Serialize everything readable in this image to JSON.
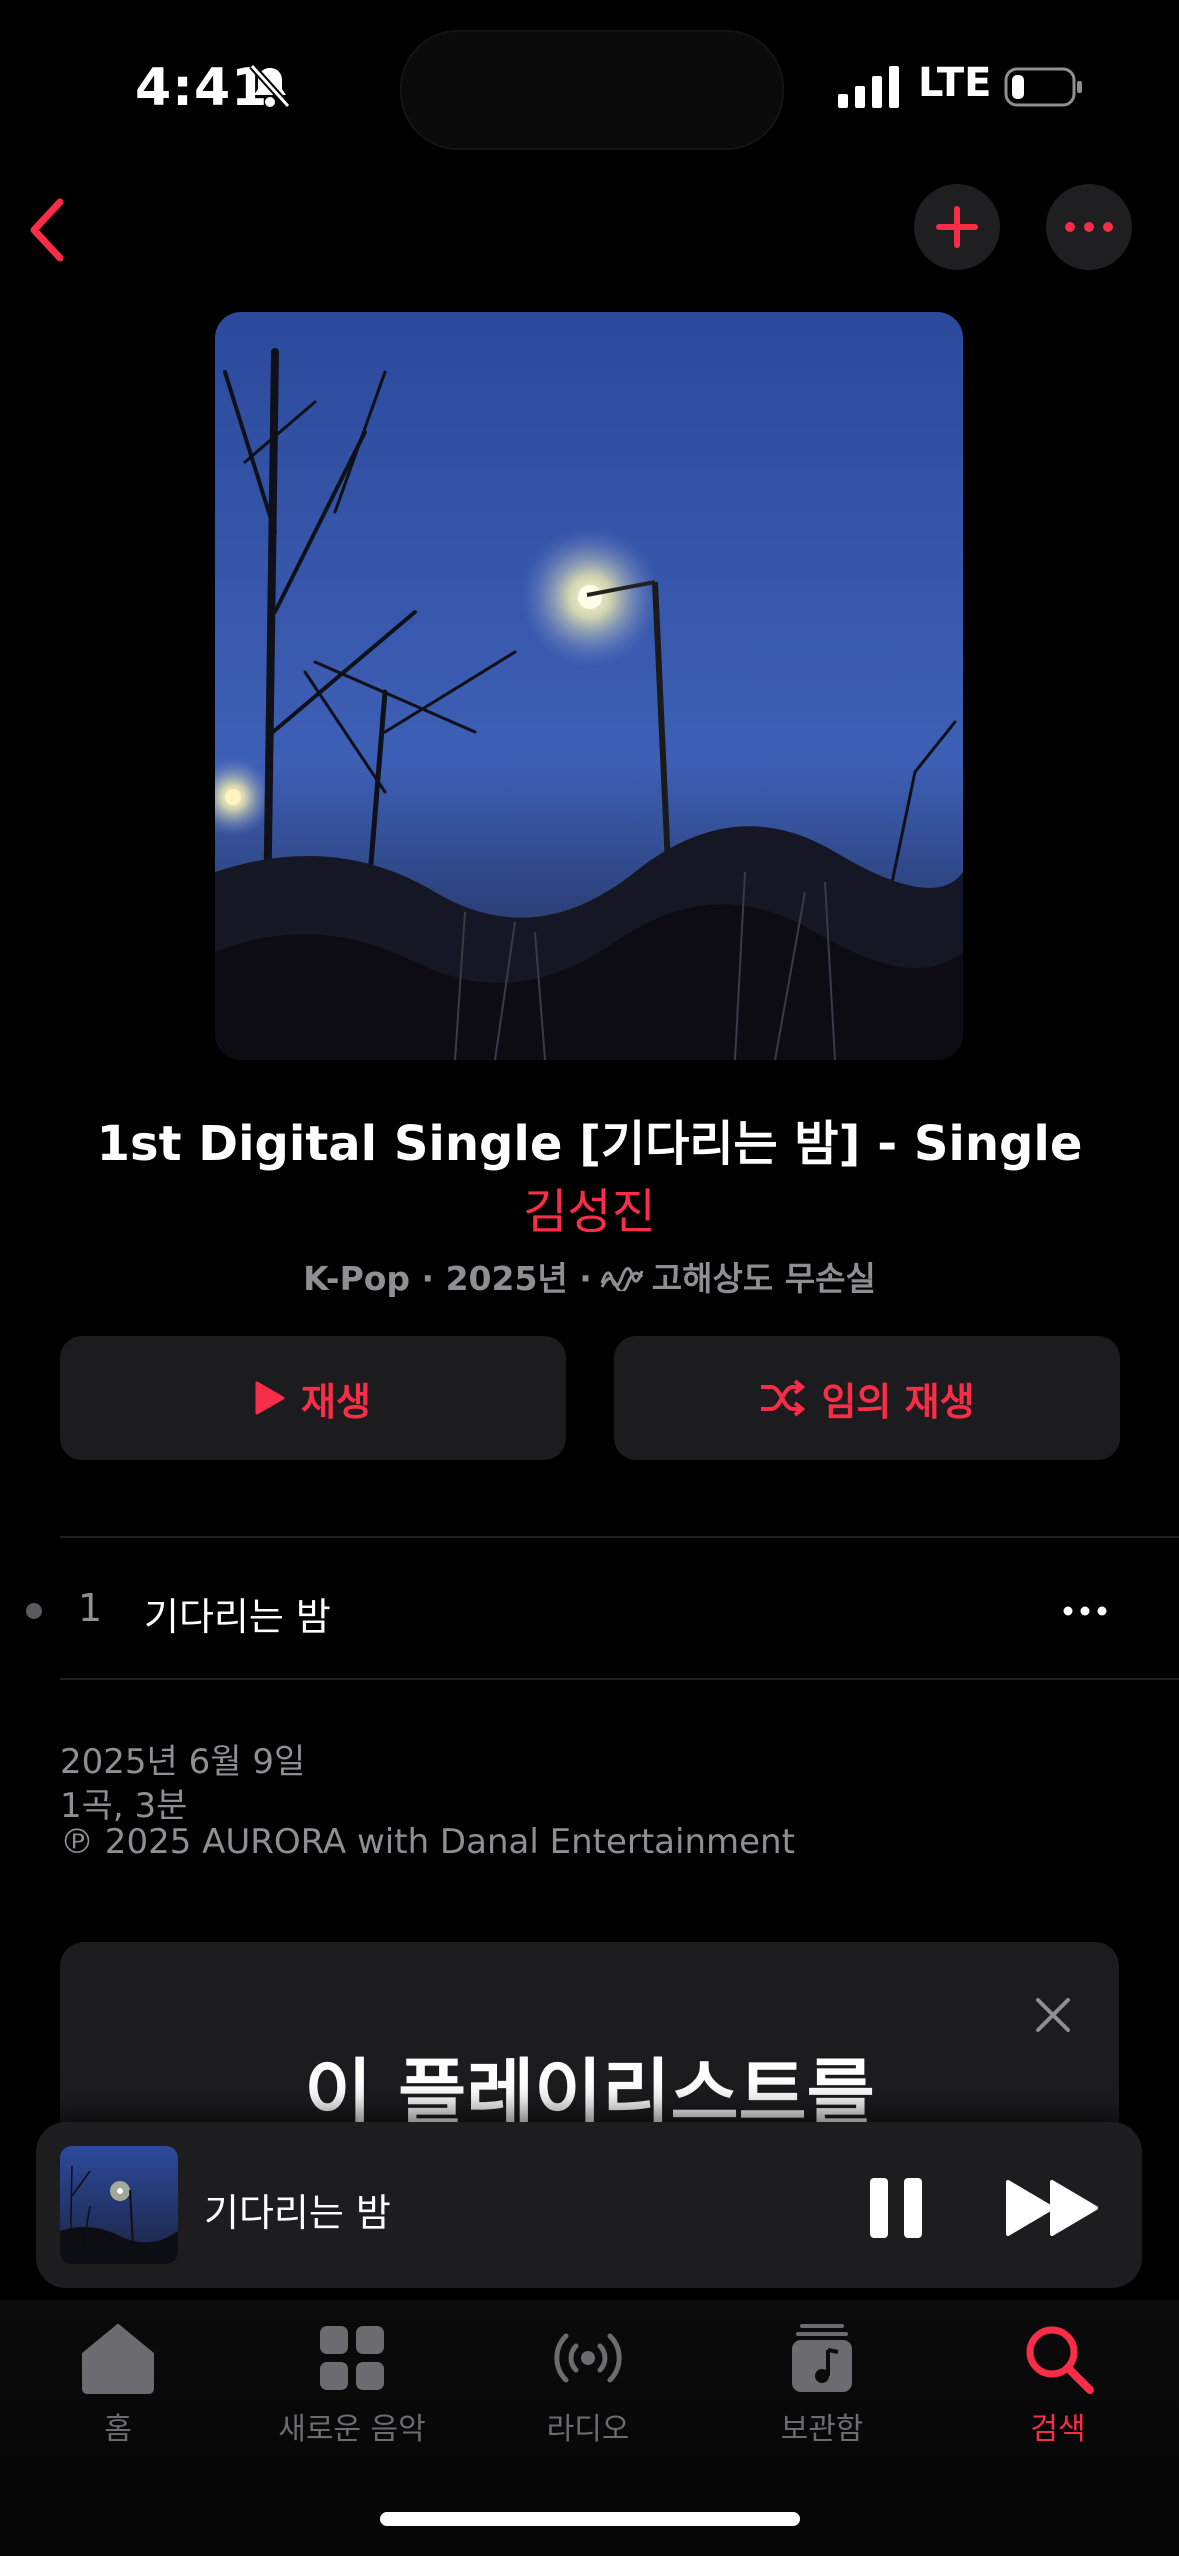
{
  "status": {
    "time": "4:41",
    "network": "LTE"
  },
  "album": {
    "title": "1st Digital Single [기다리는 밤] - Single",
    "artist": "김성진",
    "genre_year": "K-Pop · 2025년 ·",
    "quality": "고해상도 무손실"
  },
  "actions": {
    "play": "재생",
    "shuffle": "임의 재생"
  },
  "tracks": [
    {
      "number": "1",
      "title": "기다리는 밤"
    }
  ],
  "info": {
    "release_date": "2025년 6월 9일",
    "count_duration": "1곡, 3분",
    "copyright": "℗ 2025 AURORA with Danal Entertainment"
  },
  "promo": {
    "title": "이 플레이리스트를"
  },
  "mini_player": {
    "title": "기다리는 밤"
  },
  "tabs": [
    {
      "label": "홈",
      "icon": "home-icon"
    },
    {
      "label": "새로운 음악",
      "icon": "grid-icon"
    },
    {
      "label": "라디오",
      "icon": "radio-icon"
    },
    {
      "label": "보관함",
      "icon": "library-icon"
    },
    {
      "label": "검색",
      "icon": "search-icon",
      "active": true
    }
  ],
  "colors": {
    "accent": "#fa2d48",
    "background": "#000000",
    "surface": "#1c1c1e"
  }
}
